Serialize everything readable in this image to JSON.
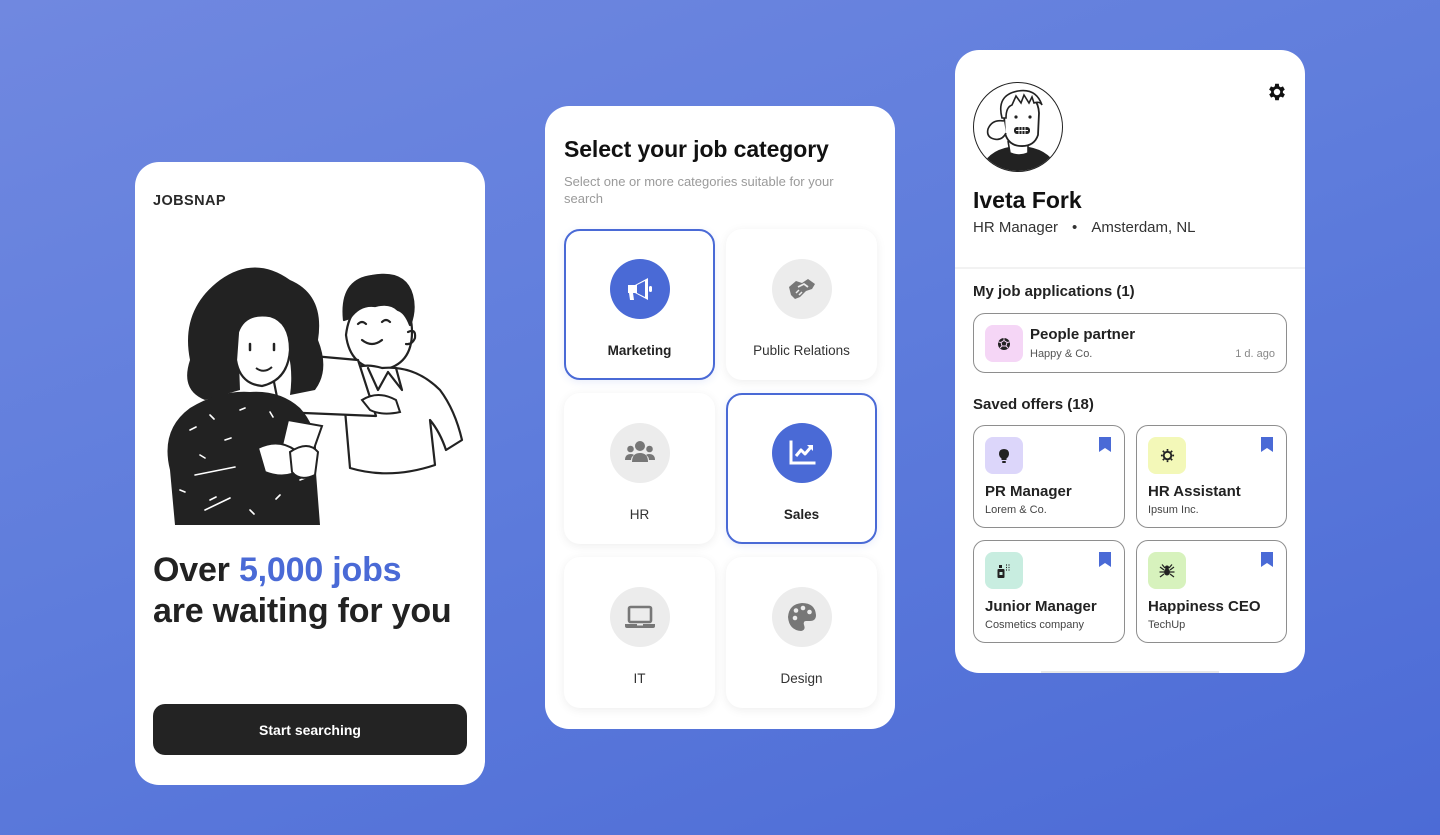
{
  "welcome": {
    "brand": "JOBSNAP",
    "headline_prefix": "Over ",
    "headline_accent": "5,000 jobs",
    "headline_suffix": " are waiting for you",
    "cta_label": "Start searching",
    "illustration": "two-people-with-phone-and-laptop"
  },
  "categories": {
    "title": "Select your job category",
    "subtitle": "Select one or more categories suitable for your search",
    "items": [
      {
        "label": "Marketing",
        "icon": "megaphone-icon",
        "selected": true
      },
      {
        "label": "Public Relations",
        "icon": "handshake-icon",
        "selected": false
      },
      {
        "label": "HR",
        "icon": "people-group-icon",
        "selected": false
      },
      {
        "label": "Sales",
        "icon": "chart-line-icon",
        "selected": true
      },
      {
        "label": "IT",
        "icon": "laptop-icon",
        "selected": false
      },
      {
        "label": "Design",
        "icon": "palette-icon",
        "selected": false
      }
    ]
  },
  "profile": {
    "name": "Iveta Fork",
    "role": "HR Manager",
    "separator": "•",
    "location": "Amsterdam, NL",
    "applications_title": "My job applications (1)",
    "applications": [
      {
        "title": "People partner",
        "company": "Happy & Co.",
        "time": "1 d. ago",
        "icon": "soccer-ball-icon",
        "logo_bg": "#f5d6f6"
      }
    ],
    "saved_title": "Saved offers (18)",
    "saved": [
      {
        "title": "PR Manager",
        "company": "Lorem & Co.",
        "icon": "lightbulb-icon",
        "logo_bg": "#dcd6fa",
        "bookmarked": true
      },
      {
        "title": "HR Assistant",
        "company": "Ipsum Inc.",
        "icon": "sun-gear-icon",
        "logo_bg": "#f3f8b8",
        "bookmarked": true
      },
      {
        "title": "Junior Manager",
        "company": "Cosmetics company",
        "icon": "spray-bottle-icon",
        "logo_bg": "#c8ede0",
        "bookmarked": true
      },
      {
        "title": "Happiness CEO",
        "company": "TechUp",
        "icon": "spider-icon",
        "logo_bg": "#d7f2bd",
        "bookmarked": true
      }
    ]
  },
  "colors": {
    "accent": "#4a6ad6",
    "background_start": "#7088e0",
    "background_end": "#4c6bd6",
    "dark_button": "#232323"
  }
}
